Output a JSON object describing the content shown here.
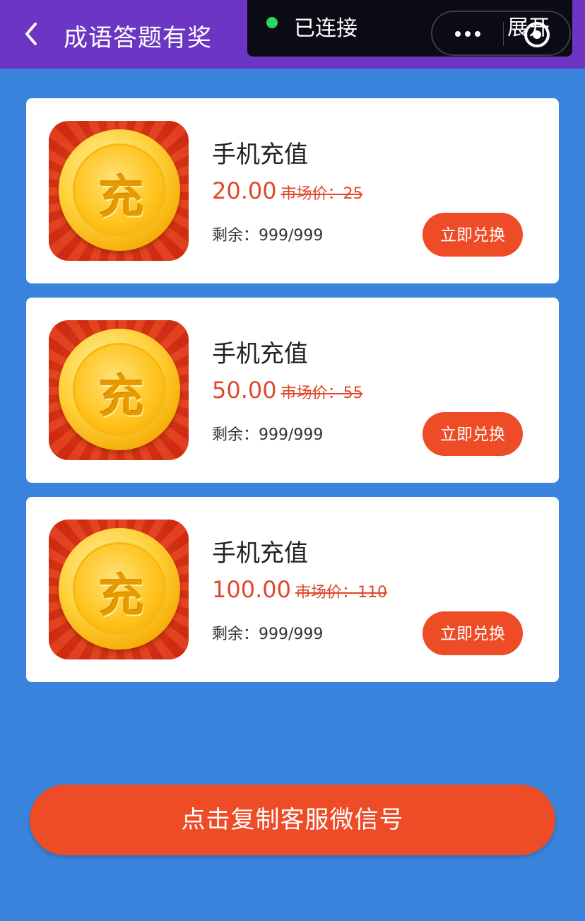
{
  "nav": {
    "title": "成语答题有奖",
    "connection_status": "已连接",
    "expand_label": "展开",
    "status_color": "#2bd65f",
    "bar_color": "#6c35c4"
  },
  "products": [
    {
      "name": "手机充值",
      "price": "20.00",
      "market_price": "市场价：25",
      "stock_label": "剩余：",
      "stock": "999/999",
      "button_label": "立即兑换",
      "icon_glyph": "充"
    },
    {
      "name": "手机充值",
      "price": "50.00",
      "market_price": "市场价：55",
      "stock_label": "剩余：",
      "stock": "999/999",
      "button_label": "立即兑换",
      "icon_glyph": "充"
    },
    {
      "name": "手机充值",
      "price": "100.00",
      "market_price": "市场价：110",
      "stock_label": "剩余：",
      "stock": "999/999",
      "button_label": "立即兑换",
      "icon_glyph": "充"
    }
  ],
  "footer": {
    "cta_label": "点击复制客服微信号"
  },
  "colors": {
    "background": "#3a83dc",
    "accent": "#ee4b27",
    "price": "#e0472a"
  }
}
